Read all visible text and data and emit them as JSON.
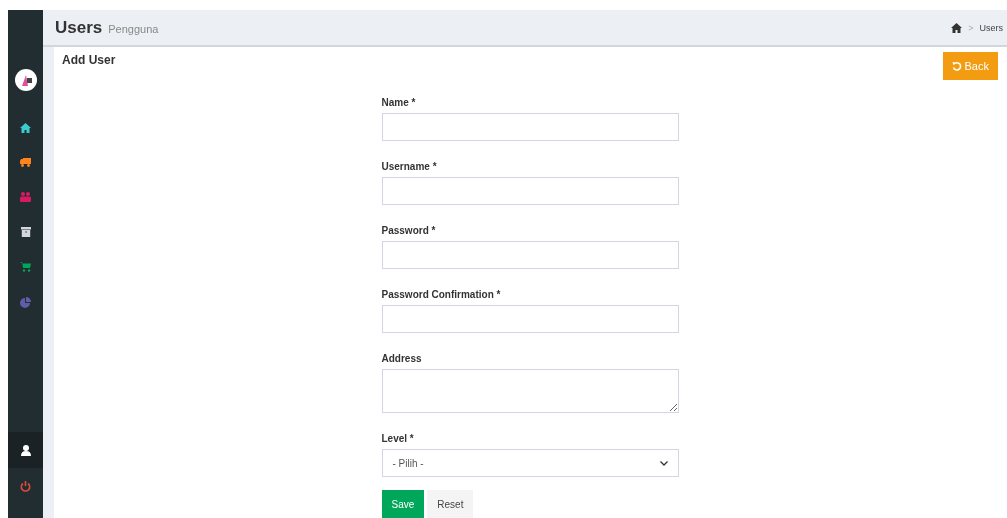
{
  "header": {
    "title": "Users",
    "subtitle": "Pengguna",
    "breadcrumb": {
      "separator": ">",
      "items": [
        "Users"
      ]
    }
  },
  "card": {
    "title": "Add User",
    "back_button": "Back"
  },
  "form": {
    "fields": [
      {
        "kind": "text",
        "label": "Name *"
      },
      {
        "kind": "text",
        "label": "Username *"
      },
      {
        "kind": "password",
        "label": "Password *"
      },
      {
        "kind": "password",
        "label": "Password Confirmation *"
      },
      {
        "kind": "textarea",
        "label": "Address"
      },
      {
        "kind": "select",
        "label": "Level *",
        "value": "- Pilih -"
      }
    ],
    "buttons": [
      {
        "kind": "primary",
        "label": "Save"
      },
      {
        "kind": "default",
        "label": "Reset"
      }
    ]
  }
}
